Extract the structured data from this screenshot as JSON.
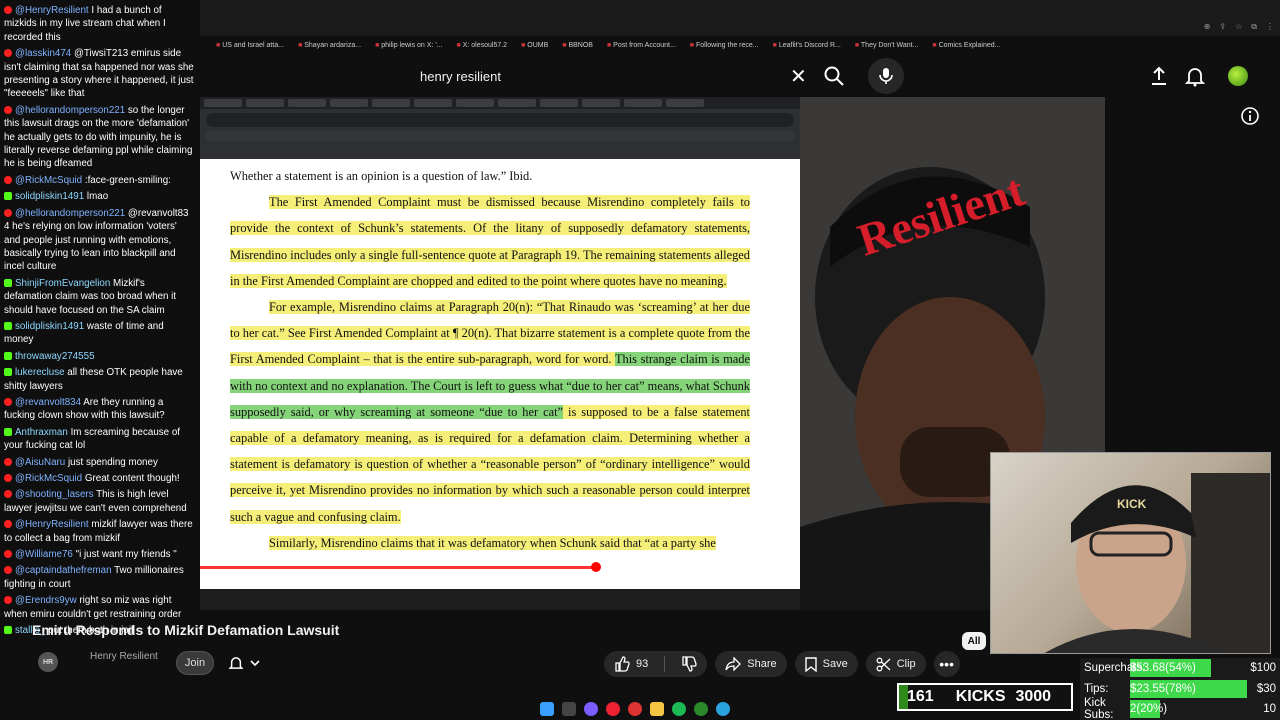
{
  "browser": {
    "bookmarks": [
      "US and Israel atta...",
      "Shayan ardariza...",
      "philip lewis on X: '...",
      "X: olesoul57.2",
      "OUMB",
      "BBNOB",
      "Post from Account...",
      "Following the rece...",
      "Leaflit's Discord R...",
      "They Don't Want...",
      "Comics Explained..."
    ]
  },
  "header": {
    "search_query": "henry resilient",
    "clear_icon": "close-icon",
    "search_icon": "search-icon",
    "mic_icon": "mic-icon",
    "upload_icon": "upload-icon",
    "bell_icon": "bell-icon"
  },
  "document": {
    "lines": [
      {
        "type": "plain",
        "text": "Whether a statement is an opinion is a question of law.”  Ibid."
      },
      {
        "type": "para_yellow",
        "text": "The First Amended Complaint must be dismissed because Misrendino completely fails to provide the context of Schunk’s statements.  Of the litany of supposedly defamatory statements, Misrendino includes only a single full-sentence quote at Paragraph 19.  The remaining statements alleged in the First Amended Complaint are chopped and edited to the point where quotes have no meaning."
      },
      {
        "type": "para_mixed",
        "yellow1": "For example, Misrendino claims at Paragraph 20(n): “That Rinaudo was ‘screaming’ at her due to her cat.”  See First Amended Complaint at ¶ 20(n).  That bizarre statement is a complete quote from the First Amended Complaint – that is the entire sub-paragraph, word for word.  ",
        "green": "This strange claim is made with no context and no explanation.  The Court is left to guess what “due to her cat” means, what Schunk supposedly said, or why screaming at someone “due to her cat”",
        "yellow2": " is supposed to be a false statement capable of a defamatory meaning, as is required for a defamation claim.  Determining whether a statement is defamatory is question of whether a “reasonable person” of “ordinary intelligence” would perceive it, yet Misrendino provides no information by which such a reasonable person could interpret such a vague and confusing claim."
      },
      {
        "type": "cut",
        "text": "Similarly, Misrendino claims that it was defamatory when Schunk said that “at a party she"
      }
    ]
  },
  "chat": [
    {
      "platform": "yt",
      "user": "@HenryResilient",
      "text": "I had a bunch of mizkids in my live stream chat when I recorded this"
    },
    {
      "platform": "yt",
      "user": "@lasskin474",
      "text": "@TiwsiT213 emirus side isn't claiming that sa happened nor was she presenting a story where it happened, it just \"feeeeels\" like that"
    },
    {
      "platform": "yt",
      "user": "@hellorandomperson221",
      "text": "so the longer this lawsuit drags on the more 'defamation' he actually gets to do with impunity, he is literally reverse defaming ppl while claiming he is being dfeamed"
    },
    {
      "platform": "yt",
      "user": "@RickMcSquid",
      "text": ":face-green-smiling:"
    },
    {
      "platform": "kick",
      "user": "solidpliskin1491",
      "text": "lmao"
    },
    {
      "platform": "yt",
      "user": "@hellorandomperson221",
      "text": "@revanvolt83 4 he's relying on low information 'voters' and people just running with emotions, basically trying to lean into blackpill and incel culture"
    },
    {
      "platform": "kick",
      "user": "ShinjiFromEvangelion",
      "text": "Mizkif's defamation claim was too broad when it should have focused on the SA claim"
    },
    {
      "platform": "kick",
      "user": "solidpliskin1491",
      "text": "waste of time and money"
    },
    {
      "platform": "kick",
      "user": "throwaway274555",
      "text": ""
    },
    {
      "platform": "kick",
      "user": "lukerecluse",
      "text": "all these OTK people have shitty lawyers"
    },
    {
      "platform": "yt",
      "user": "@revanvolt834",
      "text": "Are they running a fucking clown show with this lawsuit?"
    },
    {
      "platform": "kick",
      "user": "Anthraxman",
      "text": "Im screaming because of your fucking cat lol"
    },
    {
      "platform": "yt",
      "user": "@AisuNaru",
      "text": "just spending money"
    },
    {
      "platform": "yt",
      "user": "@RickMcSquid",
      "text": "Great content though!"
    },
    {
      "platform": "yt",
      "user": "@shooting_lasers",
      "text": "This is high level lawyer jewjitsu we can't even comprehend"
    },
    {
      "platform": "yt",
      "user": "@HenryResilient",
      "text": "mizkif lawyer was there to collect a bag from mizkif"
    },
    {
      "platform": "yt",
      "user": "@Williame76",
      "text": "\"i just want my friends \""
    },
    {
      "platform": "yt",
      "user": "@captaindathefreman",
      "text": "Two millionaires fighting in court"
    },
    {
      "platform": "yt",
      "user": "@Erendrs9yw",
      "text": "right so miz was right when emiru couldn't get restraining order"
    },
    {
      "platform": "kick",
      "user": "stallio_",
      "text": "put them both in jail"
    }
  ],
  "video": {
    "title": "Emiru Responds to Mizkif Defamation Lawsuit",
    "channel": "Henry Resilient",
    "channel_avatar": "HR",
    "join_label": "Join",
    "like_count": "93",
    "share_label": "Share",
    "save_label": "Save",
    "clip_label": "Clip",
    "more_label": "•••",
    "filter_chip": "All",
    "progress": 0.66
  },
  "widgets": {
    "kicks": {
      "current": "161",
      "label": "KICKS",
      "goal": "3000",
      "fraction": 0.054
    },
    "goals": [
      {
        "label": "Superchats:",
        "amount": "$53.68(54%)",
        "goal": "$100",
        "fraction": 0.54
      },
      {
        "label": "Tips:",
        "amount": "$23.55(78%)",
        "goal": "$30",
        "fraction": 0.78
      },
      {
        "label": "Kick Subs:",
        "amount": "2(20%)",
        "goal": "10",
        "fraction": 0.2
      }
    ]
  },
  "colors": {
    "highlight_yellow": "#f5ef7a",
    "highlight_green": "#86d47a",
    "youtube_red": "#ff0000",
    "kick_green": "#53fc18",
    "goal_green": "#3ed94a"
  }
}
